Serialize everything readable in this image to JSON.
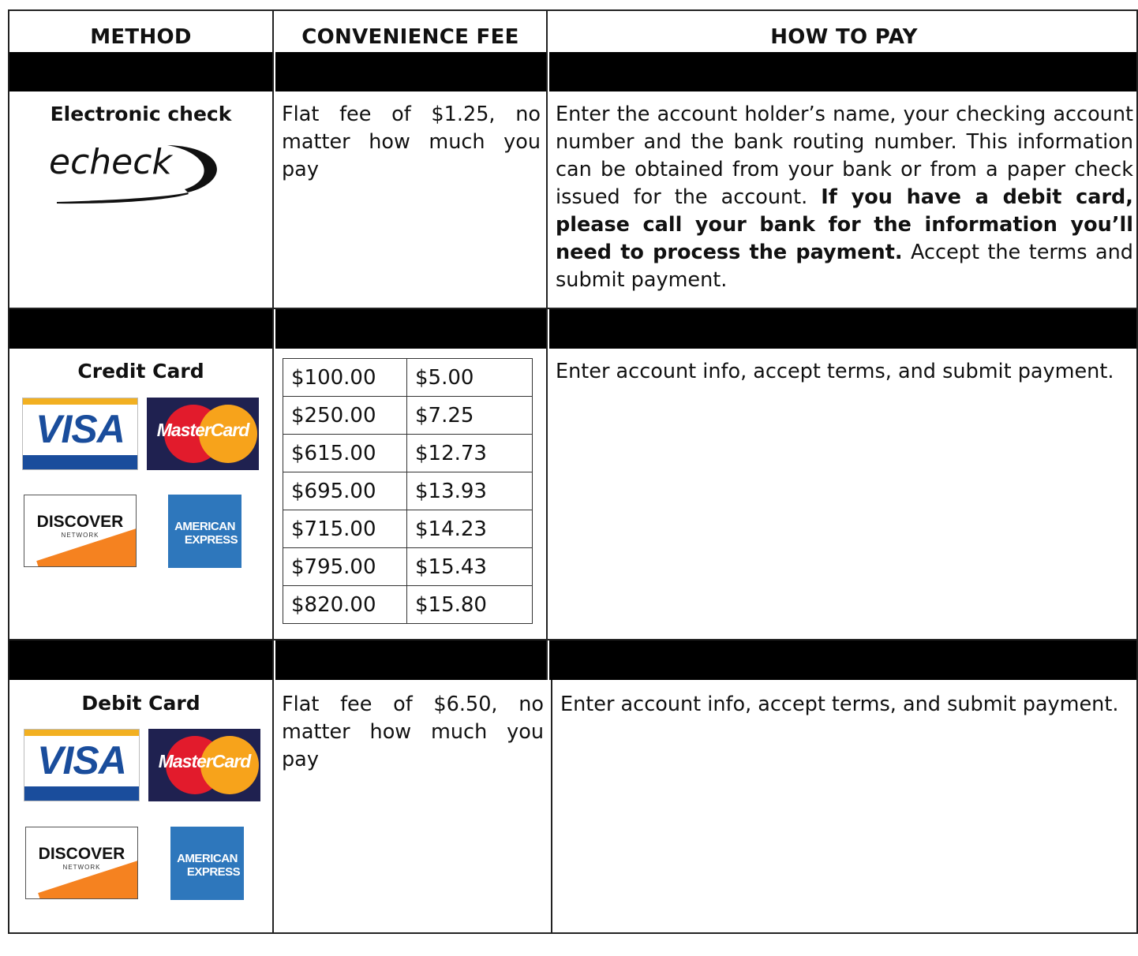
{
  "headers": {
    "method": "METHOD",
    "fee": "CONVENIENCE FEE",
    "how": "HOW TO PAY"
  },
  "echeck": {
    "title": "Electronic check",
    "logo_text": "echeck",
    "fee": "Flat fee of $1.25, no matter how much you pay",
    "how_normal": "Enter the account holder’s name, your checking account number and the bank routing number. This information can be obtained from your bank or from a paper check issued for the account. ",
    "how_bold": "If you have a debit card, please call your bank for the information you’ll need to process the payment.",
    "how_end": " Accept the terms and submit payment."
  },
  "credit": {
    "title": "Credit Card",
    "fee_table": [
      [
        "$100.00",
        "$5.00"
      ],
      [
        "$250.00",
        "$7.25"
      ],
      [
        "$615.00",
        "$12.73"
      ],
      [
        "$695.00",
        "$13.93"
      ],
      [
        "$715.00",
        "$14.23"
      ],
      [
        "$795.00",
        "$15.43"
      ],
      [
        "$820.00",
        "$15.80"
      ]
    ],
    "how": "Enter account info, accept terms, and submit payment."
  },
  "debit": {
    "title": "Debit Card",
    "fee": "Flat fee of $6.50, no matter how much you pay",
    "how": "Enter account info, accept terms, and submit payment."
  },
  "logos": {
    "visa": "VISA",
    "mastercard": "MasterCard",
    "discover": "DISCOVER",
    "discover_sub": "NETWORK",
    "amex_1": "AMERICAN",
    "amex_2": "EXPRESS"
  }
}
